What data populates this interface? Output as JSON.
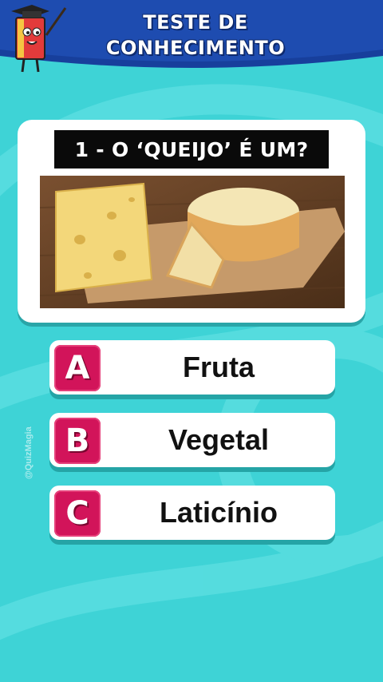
{
  "header": {
    "title_line1": "TESTE DE",
    "title_line2": "CONHECIMENTO",
    "mascot_icon": "book-mascot-icon"
  },
  "question": {
    "text": "1 - O ‘QUEIJO’ É UM?",
    "image_icon": "cheese-photo"
  },
  "options": [
    {
      "letter": "A",
      "label": "Fruta"
    },
    {
      "letter": "B",
      "label": "Vegetal"
    },
    {
      "letter": "C",
      "label": "Laticínio"
    }
  ],
  "watermark": "@QuizMagia",
  "colors": {
    "background": "#3ed3d6",
    "header": "#173f9c",
    "accent": "#d2145a",
    "card": "#ffffff"
  }
}
